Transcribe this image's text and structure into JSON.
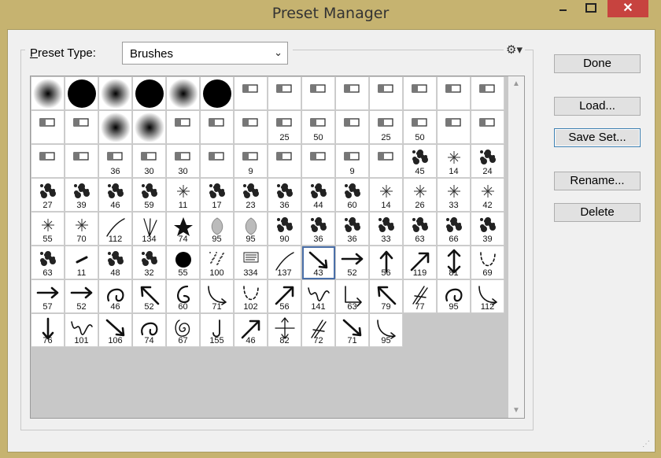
{
  "window": {
    "title": "Preset Manager",
    "minimize_glyph": "minimize",
    "maximize_glyph": "maximize",
    "close_glyph": "✕"
  },
  "preset_type": {
    "label_accel": "P",
    "label_rest": "reset Type:",
    "value": "Brushes",
    "arrow": "⌄"
  },
  "menu_icon": "gear-icon",
  "buttons": {
    "done": "Done",
    "load": "Load...",
    "save_set": "Save Set...",
    "rename": "Rename...",
    "delete": "Delete"
  },
  "selected_index": 78,
  "brushes": [
    {
      "label": "",
      "type": "soft"
    },
    {
      "label": "",
      "type": "hard"
    },
    {
      "label": "",
      "type": "soft"
    },
    {
      "label": "",
      "type": "hard"
    },
    {
      "label": "",
      "type": "soft"
    },
    {
      "label": "",
      "type": "hard"
    },
    {
      "label": "",
      "type": "tool"
    },
    {
      "label": "",
      "type": "tool"
    },
    {
      "label": "",
      "type": "tool"
    },
    {
      "label": "",
      "type": "tool"
    },
    {
      "label": "",
      "type": "tool"
    },
    {
      "label": "",
      "type": "tool"
    },
    {
      "label": "",
      "type": "tool"
    },
    {
      "label": "",
      "type": "tool"
    },
    {
      "label": "",
      "type": "tool"
    },
    {
      "label": "",
      "type": "tool"
    },
    {
      "label": "",
      "type": "soft"
    },
    {
      "label": "",
      "type": "soft"
    },
    {
      "label": "",
      "type": "tool"
    },
    {
      "label": "",
      "type": "tool"
    },
    {
      "label": "",
      "type": "tool"
    },
    {
      "label": "25",
      "type": "tool"
    },
    {
      "label": "50",
      "type": "tool"
    },
    {
      "label": "",
      "type": "tool"
    },
    {
      "label": "25",
      "type": "tool"
    },
    {
      "label": "50",
      "type": "tool"
    },
    {
      "label": "",
      "type": "tool"
    },
    {
      "label": "",
      "type": "tool"
    },
    {
      "label": "",
      "type": "tool"
    },
    {
      "label": "",
      "type": "tool"
    },
    {
      "label": "36",
      "type": "tool"
    },
    {
      "label": "30",
      "type": "tool"
    },
    {
      "label": "30",
      "type": "tool"
    },
    {
      "label": "",
      "type": "tool"
    },
    {
      "label": "9",
      "type": "tool"
    },
    {
      "label": "",
      "type": "tool"
    },
    {
      "label": "",
      "type": "tool"
    },
    {
      "label": "9",
      "type": "tool"
    },
    {
      "label": "",
      "type": "tool"
    },
    {
      "label": "45",
      "type": "splat"
    },
    {
      "label": "14",
      "type": "spark"
    },
    {
      "label": "24",
      "type": "splat"
    },
    {
      "label": "27",
      "type": "splat"
    },
    {
      "label": "39",
      "type": "splat"
    },
    {
      "label": "46",
      "type": "splat"
    },
    {
      "label": "59",
      "type": "splat"
    },
    {
      "label": "11",
      "type": "spark"
    },
    {
      "label": "17",
      "type": "splat"
    },
    {
      "label": "23",
      "type": "splat"
    },
    {
      "label": "36",
      "type": "splat"
    },
    {
      "label": "44",
      "type": "splat"
    },
    {
      "label": "60",
      "type": "splat"
    },
    {
      "label": "14",
      "type": "spark"
    },
    {
      "label": "26",
      "type": "spark"
    },
    {
      "label": "33",
      "type": "spark"
    },
    {
      "label": "42",
      "type": "spark"
    },
    {
      "label": "55",
      "type": "spark"
    },
    {
      "label": "70",
      "type": "spark"
    },
    {
      "label": "112",
      "type": "stroke"
    },
    {
      "label": "134",
      "type": "grass"
    },
    {
      "label": "74",
      "type": "leaf"
    },
    {
      "label": "95",
      "type": "leafsoft"
    },
    {
      "label": "95",
      "type": "leafsoft"
    },
    {
      "label": "90",
      "type": "splat"
    },
    {
      "label": "36",
      "type": "splat"
    },
    {
      "label": "36",
      "type": "splat"
    },
    {
      "label": "33",
      "type": "splat"
    },
    {
      "label": "63",
      "type": "splat"
    },
    {
      "label": "66",
      "type": "splat"
    },
    {
      "label": "39",
      "type": "splat"
    },
    {
      "label": "63",
      "type": "splat"
    },
    {
      "label": "11",
      "type": "dash"
    },
    {
      "label": "48",
      "type": "splat"
    },
    {
      "label": "32",
      "type": "splat"
    },
    {
      "label": "55",
      "type": "dot"
    },
    {
      "label": "100",
      "type": "speckle"
    },
    {
      "label": "334",
      "type": "text"
    },
    {
      "label": "137",
      "type": "diag"
    },
    {
      "label": "43",
      "type": "arrow-se"
    },
    {
      "label": "52",
      "type": "arrow-e"
    },
    {
      "label": "56",
      "type": "arrow-n"
    },
    {
      "label": "119",
      "type": "arrow-ne"
    },
    {
      "label": "81",
      "type": "arrow-ud"
    },
    {
      "label": "69",
      "type": "dashed-u"
    },
    {
      "label": "57",
      "type": "arrow-e"
    },
    {
      "label": "52",
      "type": "arrow-e"
    },
    {
      "label": "46",
      "type": "loop"
    },
    {
      "label": "52",
      "type": "arrow-nw"
    },
    {
      "label": "60",
      "type": "curl"
    },
    {
      "label": "71",
      "type": "curve"
    },
    {
      "label": "102",
      "type": "dashed-u"
    },
    {
      "label": "56",
      "type": "arrow-ne"
    },
    {
      "label": "141",
      "type": "squiggle"
    },
    {
      "label": "63",
      "type": "corner"
    },
    {
      "label": "79",
      "type": "arrow-nw"
    },
    {
      "label": "77",
      "type": "sketch"
    },
    {
      "label": "95",
      "type": "loop"
    },
    {
      "label": "112",
      "type": "curve"
    },
    {
      "label": "76",
      "type": "arrow-s"
    },
    {
      "label": "101",
      "type": "squiggle"
    },
    {
      "label": "106",
      "type": "arrow-se"
    },
    {
      "label": "74",
      "type": "loop"
    },
    {
      "label": "67",
      "type": "spiral"
    },
    {
      "label": "155",
      "type": "hook"
    },
    {
      "label": "46",
      "type": "arrow-ne"
    },
    {
      "label": "82",
      "type": "cross"
    },
    {
      "label": "72",
      "type": "sketch"
    },
    {
      "label": "71",
      "type": "arrow-se"
    },
    {
      "label": "95",
      "type": "curve"
    }
  ]
}
